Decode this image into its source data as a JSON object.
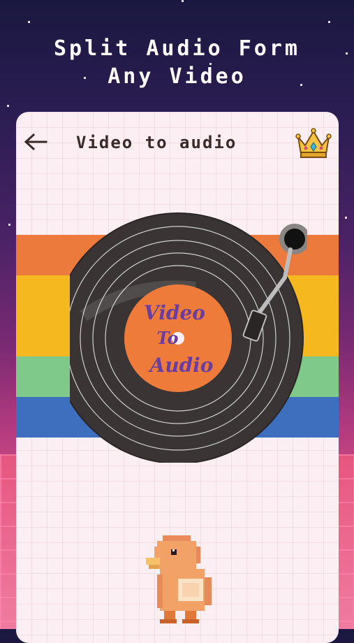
{
  "promo": {
    "line1": "Split Audio Form",
    "line2": "Any Video"
  },
  "header": {
    "title": "Video to audio"
  },
  "icons": {
    "back": "arrow-left-icon",
    "premium": "crown-icon"
  },
  "record_label": {
    "line1": "Video",
    "line2": "To",
    "line3": "Audio"
  },
  "colors": {
    "stripe_orange": "#ec7a3c",
    "stripe_yellow": "#f6b81f",
    "stripe_green": "#7fc98a",
    "stripe_blue": "#3e6fbf",
    "label_orange": "#ef7b3a",
    "label_text": "#6a3da0"
  }
}
